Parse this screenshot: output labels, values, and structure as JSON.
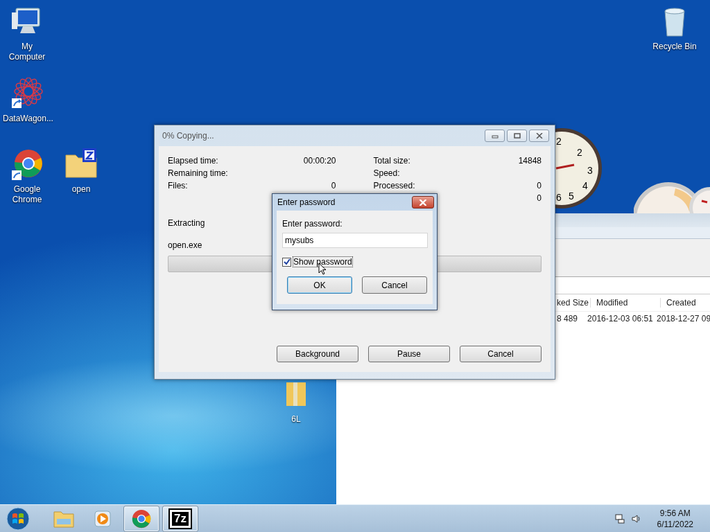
{
  "desktop_icons": [
    {
      "label": "My Computer",
      "kind": "computer"
    },
    {
      "label": "DataWagon...",
      "kind": "web_shortcut"
    },
    {
      "label": "Google Chrome",
      "kind": "chrome"
    },
    {
      "label": "open",
      "kind": "zip_folder"
    },
    {
      "label": "Recycle Bin",
      "kind": "recycle"
    },
    {
      "label": "6L",
      "kind": "folder"
    }
  ],
  "clock_gadget": {
    "numerals": [
      "2",
      "2",
      "3",
      "4",
      "6",
      "5"
    ]
  },
  "background_window": {
    "columns": [
      "ked Size",
      "Modified",
      "Created"
    ],
    "rows": [
      [
        "8 489",
        "2016-12-03 06:51",
        "2018-12-27 09"
      ]
    ]
  },
  "copy_dialog": {
    "title": "0% Copying...",
    "stats_left": [
      {
        "label": "Elapsed time:",
        "value": "00:00:20"
      },
      {
        "label": "Remaining time:"
      },
      {
        "label": "Files:",
        "value": "0"
      }
    ],
    "stats_right": [
      {
        "label": "Total size:",
        "value": "14848"
      },
      {
        "label": "Speed:"
      },
      {
        "label": "Processed:",
        "value": "0"
      },
      {
        "value": "0"
      }
    ],
    "operation": "Extracting",
    "file": "open.exe",
    "progress": {
      "level": 0
    },
    "buttons": [
      "Background",
      "Pause",
      "Cancel"
    ]
  },
  "password_dialog": {
    "title": "Enter password",
    "field_label": "Enter password:",
    "value": "mysubs",
    "show_password": {
      "label": "Show password",
      "checked": true
    },
    "buttons": [
      {
        "label": "OK",
        "default": true
      },
      {
        "label": "Cancel",
        "default": false
      }
    ]
  },
  "taskbar": {
    "items": [
      {
        "kind": "explorer",
        "selected": false
      },
      {
        "kind": "media",
        "selected": false
      },
      {
        "kind": "chrome",
        "selected": true
      },
      {
        "kind": "sevenzip",
        "label": "7z",
        "selected": true
      }
    ],
    "clock": {
      "time": "9:56 AM",
      "date": "6/11/2022"
    }
  }
}
